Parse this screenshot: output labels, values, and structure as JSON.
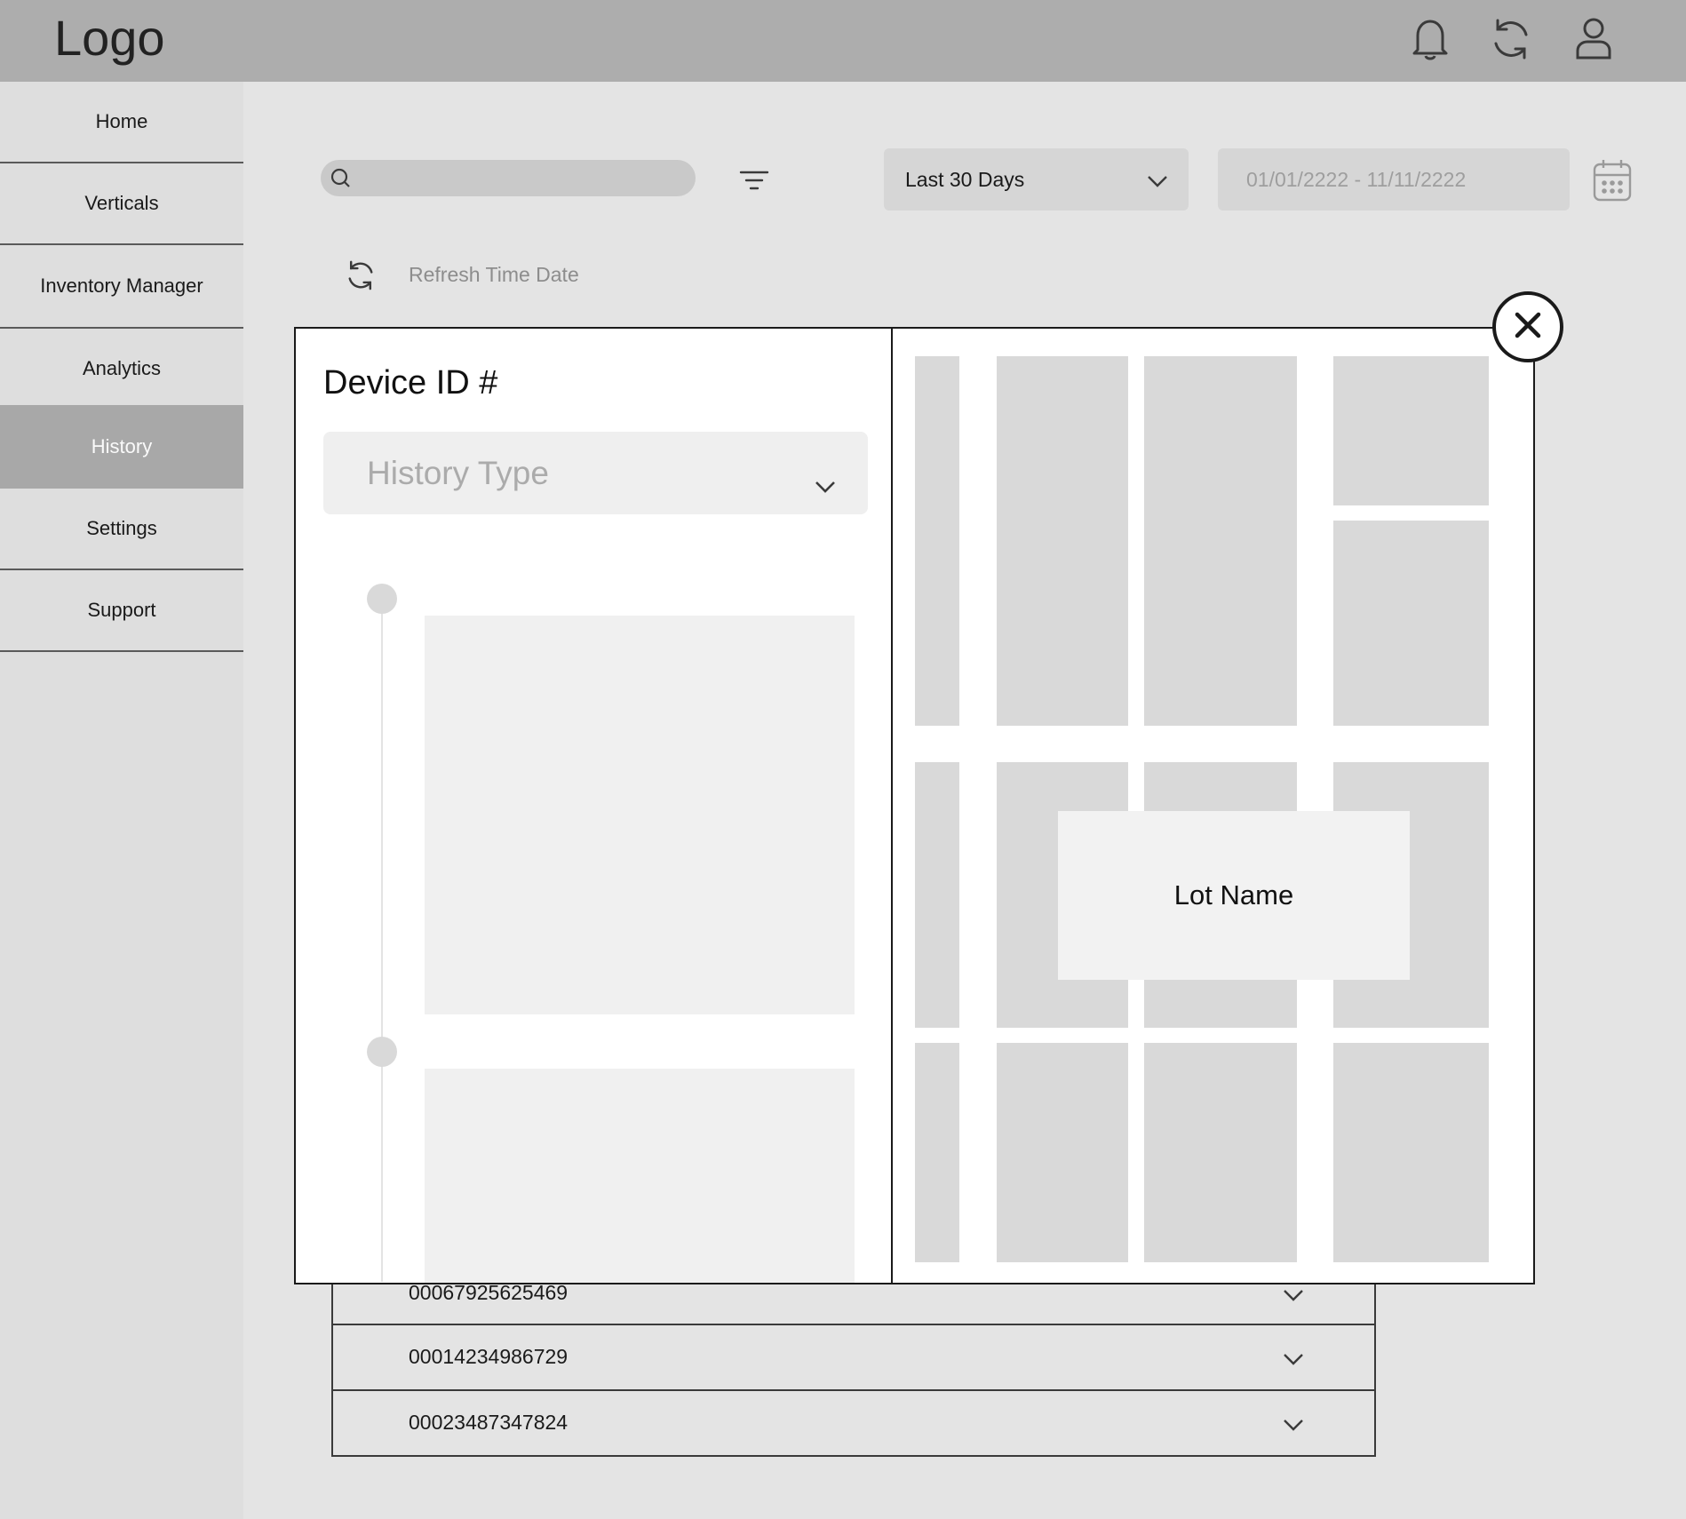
{
  "header": {
    "logo": "Logo",
    "icons": [
      "bell-icon",
      "sync-icon",
      "user-icon"
    ]
  },
  "sidebar": {
    "items": [
      {
        "label": "Home",
        "active": false
      },
      {
        "label": "Verticals",
        "active": false
      },
      {
        "label": "Inventory Manager",
        "active": false
      },
      {
        "label": "Analytics",
        "active": false
      },
      {
        "label": "History",
        "active": true
      },
      {
        "label": "Settings",
        "active": false
      },
      {
        "label": "Support",
        "active": false
      }
    ]
  },
  "toolbar": {
    "search_placeholder": "",
    "range_selected": "Last 30 Days",
    "date_range_placeholder": "01/01/2222 - 11/11/2222",
    "refresh_label": "Refresh Time Date"
  },
  "list": {
    "rows": [
      {
        "id": "00067925625469"
      },
      {
        "id": "00014234986729"
      },
      {
        "id": "00023487347824"
      }
    ]
  },
  "modal": {
    "title": "Device ID #",
    "history_type_placeholder": "History Type",
    "map": {
      "lot_name": "Lot Name"
    }
  },
  "colors": {
    "topbar": "#adadad",
    "sidebar_active": "#a8a8a8",
    "background": "#e4e4e4",
    "map_block": "#d9d9d9"
  }
}
